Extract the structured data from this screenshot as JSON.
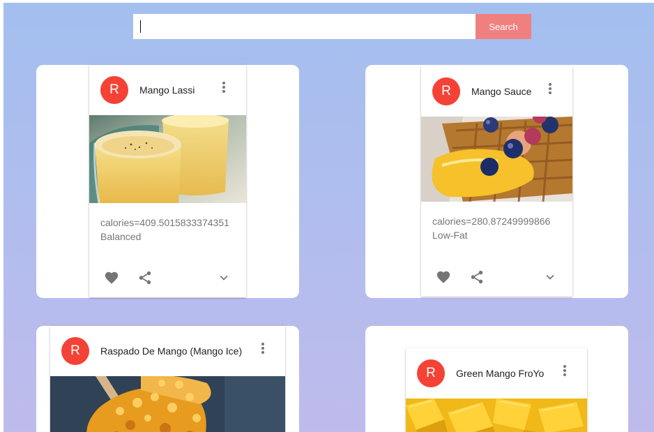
{
  "search": {
    "value": "",
    "placeholder": "",
    "button_label": "Search"
  },
  "cards": [
    {
      "avatar_letter": "R",
      "title": "Mango Lassi",
      "calories": "calories=409.5015833374351",
      "diet": "Balanced",
      "image": "mango-lassi-photo"
    },
    {
      "avatar_letter": "R",
      "title": "Mango Sauce",
      "calories": "calories=280.87249999866",
      "diet": "Low-Fat",
      "image": "mango-sauce-waffle-photo"
    },
    {
      "avatar_letter": "R",
      "title": "Raspado De Mango (Mango Ice)",
      "image": "mango-ice-photo"
    },
    {
      "avatar_letter": "R",
      "title": "Green Mango FroYo",
      "image": "green-mango-froyo-photo"
    }
  ],
  "icons": {
    "more": "more-vert-icon",
    "favorite": "heart-icon",
    "share": "share-icon",
    "expand": "chevron-down-icon"
  },
  "colors": {
    "background_top": "#a3bfef",
    "background_bottom": "#bfbbec",
    "avatar": "#f44336",
    "search_button": "#f08080",
    "icon": "#757575"
  }
}
